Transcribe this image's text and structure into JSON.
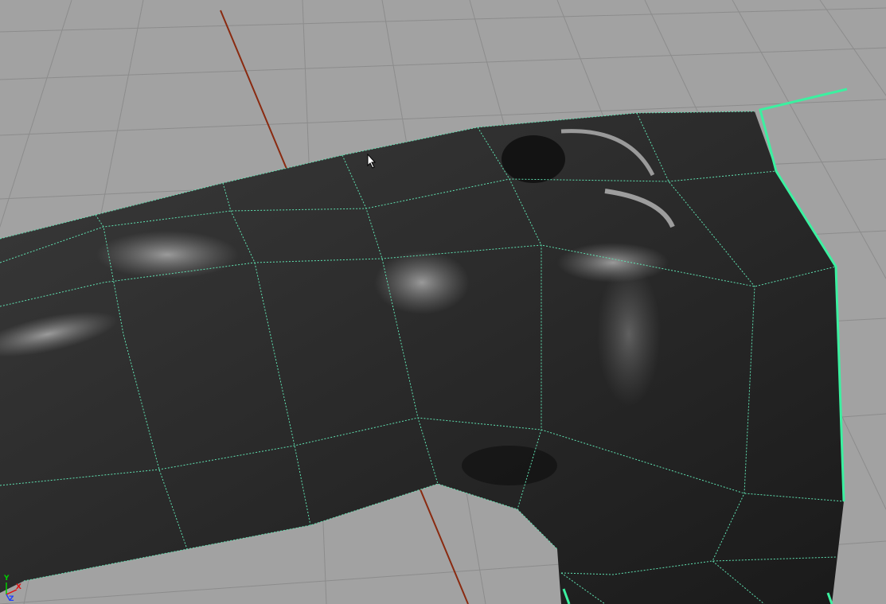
{
  "viewport": {
    "background_color": "#a2a2a2",
    "grid_color": "#8c8c8c",
    "origin_axis_color": "#8a2a10",
    "wireframe_color": "#5fe0b0",
    "selected_edge_color": "#3cf0a0",
    "cursor_icon": "arrow-cursor"
  },
  "axis_indicator": {
    "x": "X",
    "y": "Y",
    "z": "Z"
  }
}
